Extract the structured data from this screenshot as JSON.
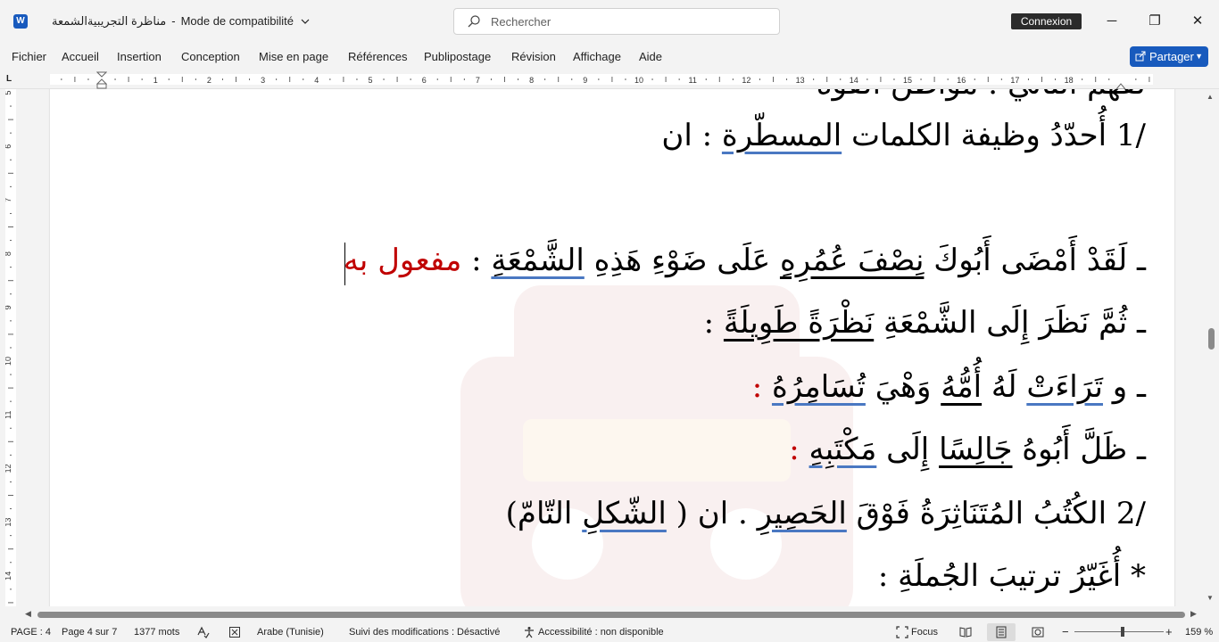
{
  "titlebar": {
    "app_icon": "word-icon",
    "doc_name": "مناظرة التجريبيةالشمعة",
    "separator": "-",
    "mode": "Mode de compatibilité",
    "search_placeholder": "Rechercher",
    "signin": "Connexion",
    "minimize": "─",
    "maximize": "❐",
    "close": "✕"
  },
  "menu": {
    "items": [
      "Fichier",
      "Accueil",
      "Insertion",
      "Conception",
      "Mise en page",
      "Références",
      "Publipostage",
      "Révision",
      "Affichage",
      "Aide"
    ],
    "share": "Partager"
  },
  "ruler": {
    "h_labels": [
      "1",
      "2",
      "3",
      "4",
      "5",
      "6",
      "7",
      "8",
      "9",
      "10",
      "11",
      "12",
      "13",
      "14",
      "15",
      "16",
      "17",
      "18"
    ],
    "v_labels": [
      "5",
      "6",
      "7",
      "8",
      "9",
      "10",
      "11",
      "12",
      "13",
      "14"
    ],
    "corner": "L"
  },
  "document": {
    "line0": "لفهم الثاني : مواطن القوة",
    "line1": {
      "num": "/1",
      "text": " أُحدّدُ وظيفة الكلمات ",
      "underlined": "المسطّرة",
      "end": " : ان"
    },
    "line2": {
      "dash": "ـ ",
      "a": "لَقَدْ أَمْضَى أَبُوكَ ",
      "b": "نِصْفَ عُمُرِهِ",
      "c": " عَلَى ضَوْءِ هَذِهِ ",
      "d": "الشَّمْعَةِ",
      "e": " : ",
      "answer": " مفعول به"
    },
    "line3": {
      "dash": "ـ ",
      "a": "ثُمَّ نَظَرَ إِلَى الشَّمْعَةِ ",
      "b": "نَظْرَةً طَوِيلَةً",
      "c": " :"
    },
    "line4": {
      "dash": "ـ ",
      "a": "و ",
      "b": "تَرَاءَتْ",
      "c": " لَهُ ",
      "d": "أُمُّهُ",
      "e": " وَهْيَ ",
      "f": "تُسَامِرُهُ",
      "g": " :"
    },
    "line5": {
      "dash": "ـ ",
      "a": "ظَلَّ أَبُوهُ ",
      "b": "جَالِسًا",
      "c": " إِلَى ",
      "d": "مَكْتَبِهِ",
      "e": " :"
    },
    "line6": {
      "num": "/2",
      "a": " الكُتُبُ المُتَنَاثِرَةُ فَوْقَ ",
      "b": "الحَصِيرِ",
      "c": " . ان ( ",
      "d": "الشّكلِ",
      "e": " التّامّ)"
    },
    "line7": "* أُغَيّرُ ترتيبَ الجُملَةِ :"
  },
  "status": {
    "page": "PAGE : 4",
    "page_of": "Page 4 sur 7",
    "words": "1377 mots",
    "language": "Arabe (Tunisie)",
    "track_changes": "Suivi des modifications : Désactivé",
    "accessibility": "Accessibilité : non disponible",
    "focus": "Focus",
    "zoom_minus": "−",
    "zoom_plus": "+",
    "zoom": "159 %"
  }
}
